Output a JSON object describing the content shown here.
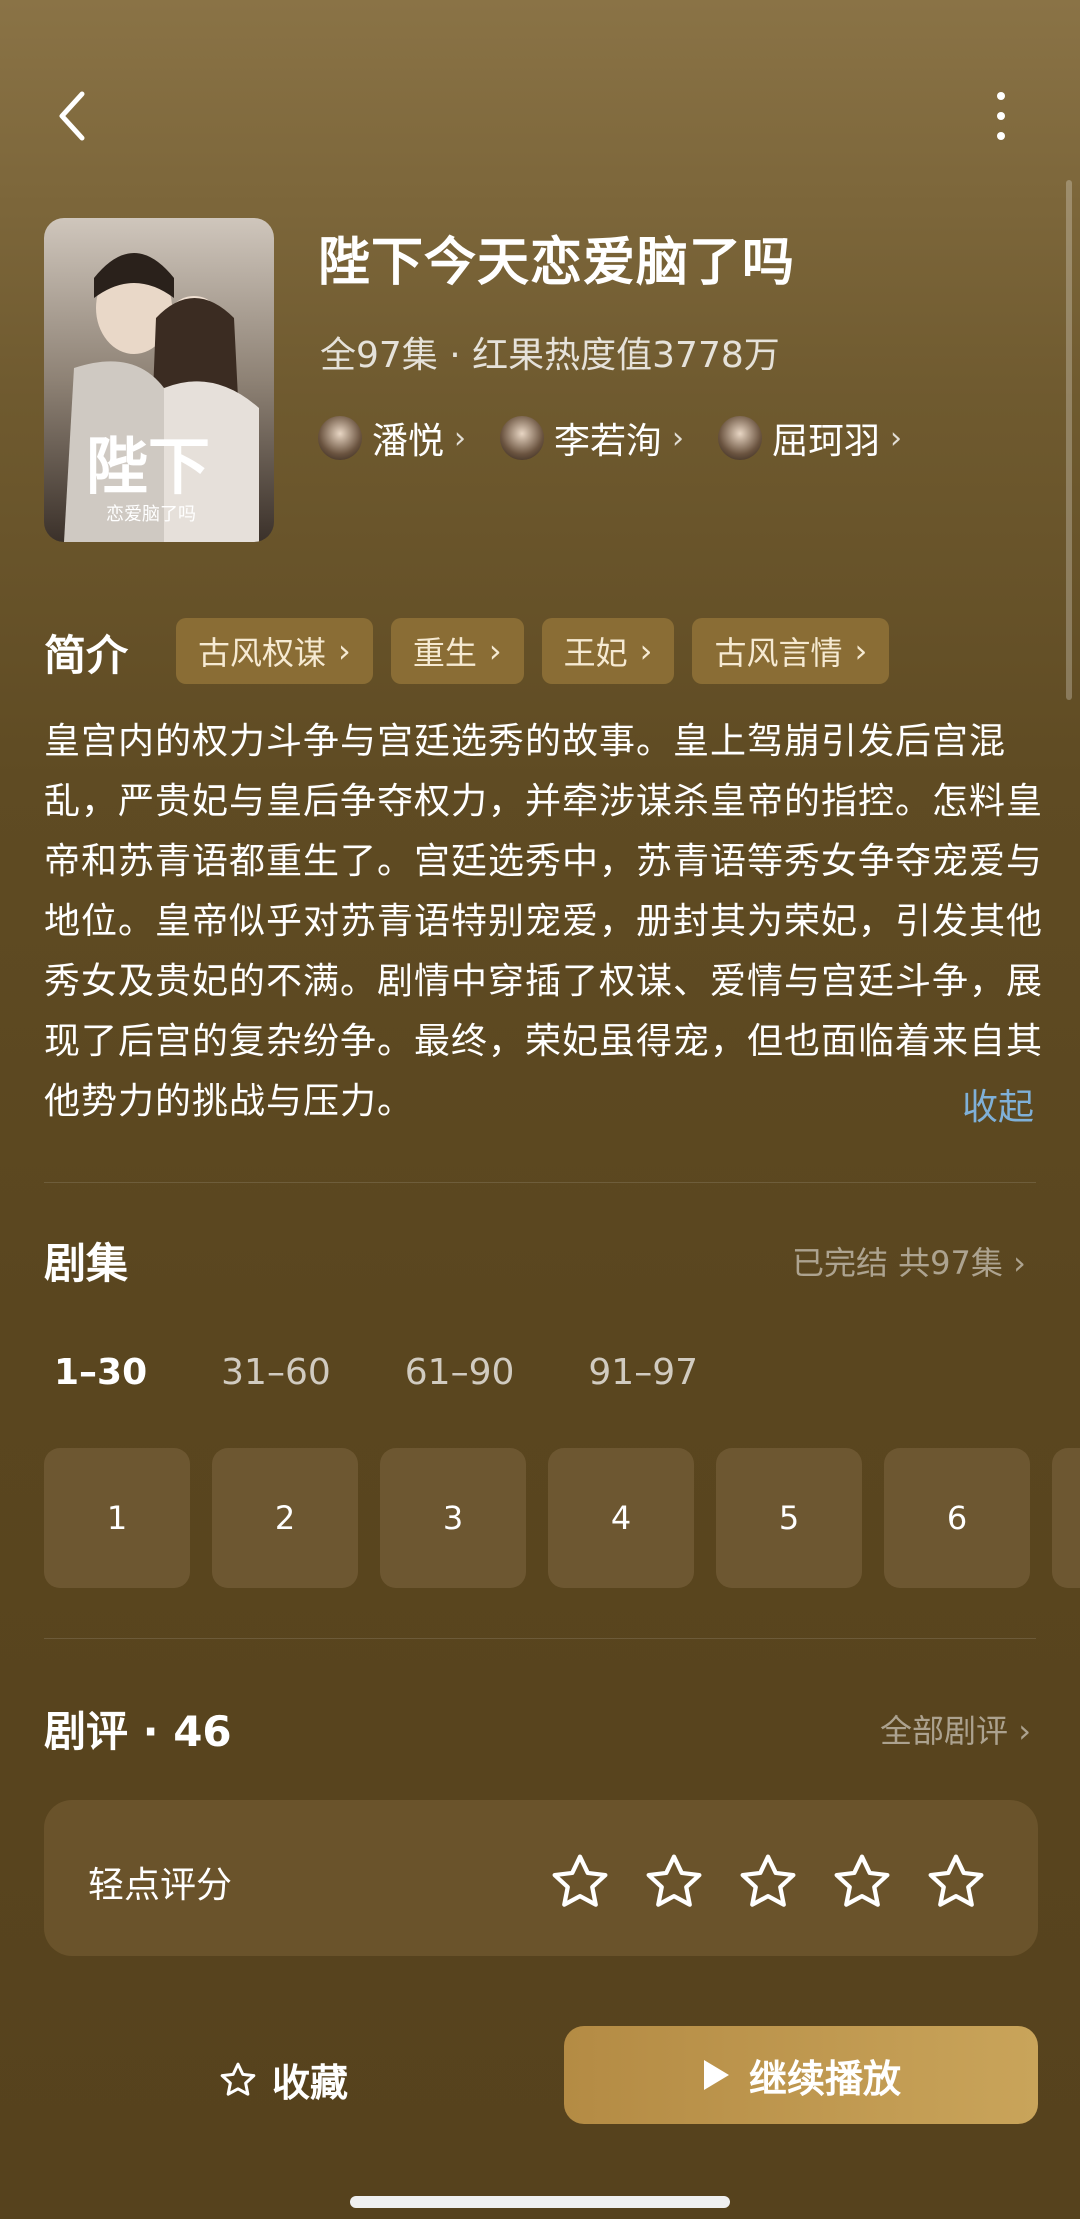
{
  "show": {
    "title": "陛下今天恋爱脑了吗",
    "meta": "全97集 · 红果热度值3778万",
    "cast": [
      {
        "name": "潘悦"
      },
      {
        "name": "李若洵"
      },
      {
        "name": "屈珂羽"
      }
    ],
    "poster_text": "陛下",
    "poster_subtext": "恋爱脑了吗"
  },
  "intro": {
    "label": "简介",
    "tags": [
      "古风权谋",
      "重生",
      "王妃",
      "古风言情"
    ],
    "description": "皇宫内的权力斗争与宫廷选秀的故事。皇上驾崩引发后宫混乱，严贵妃与皇后争夺权力，并牵涉谋杀皇帝的指控。怎料皇帝和苏青语都重生了。宫廷选秀中，苏青语等秀女争夺宠爱与地位。皇帝似乎对苏青语特别宠爱，册封其为荣妃，引发其他秀女及贵妃的不满。剧情中穿插了权谋、爱情与宫廷斗争，展现了后宫的复杂纷争。最终，荣妃虽得宠，但也面临着来自其他势力的挑战与压力。",
    "collapse_label": "收起"
  },
  "episodes": {
    "label": "剧集",
    "status": "已完结 共97集",
    "ranges": [
      "1–30",
      "31–60",
      "61–90",
      "91–97"
    ],
    "items": [
      "1",
      "2",
      "3",
      "4",
      "5",
      "6"
    ]
  },
  "reviews": {
    "label": "剧评 · 46",
    "all_label": "全部剧评",
    "rate_label": "轻点评分",
    "rating": 0,
    "max_rating": 5
  },
  "bottom": {
    "favorite_label": "收藏",
    "play_label": "继续播放"
  },
  "colors": {
    "accent": "#c9a45a",
    "link": "#7fb0d8",
    "tag_bg": "#8a6d35"
  }
}
